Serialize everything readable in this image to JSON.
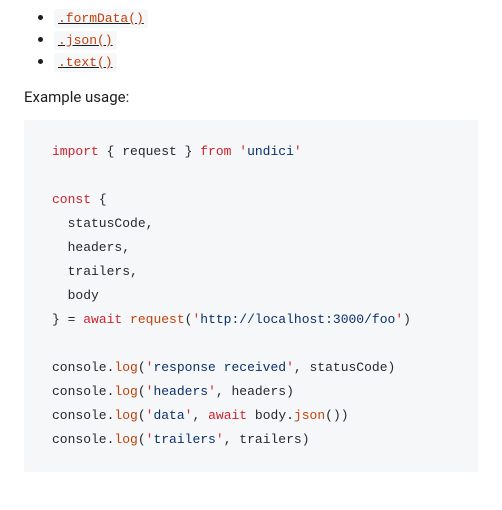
{
  "api_links": [
    ".formData()",
    ".json()",
    ".text()"
  ],
  "example_label": "Example usage:",
  "code": {
    "l1_import": "import",
    "l1_brace_open": " { ",
    "l1_request": "request",
    "l1_brace_close": " } ",
    "l1_from": "from",
    "l1_sp": " ",
    "l1_q1": "'",
    "l1_pkg": "undici",
    "l1_q2": "'",
    "l3_const": "const",
    "l3_rest": " {",
    "l4": "  statusCode,",
    "l5": "  headers,",
    "l6": "  trailers,",
    "l7": "  body",
    "l8_close": "} = ",
    "l8_await": "await",
    "l8_sp": " ",
    "l8_req": "request",
    "l8_paren_open": "(",
    "l8_q1": "'",
    "l8_url": "http://localhost:3000/foo",
    "l8_q2": "'",
    "l8_paren_close": ")",
    "l10_console": "console.",
    "l10_log": "log",
    "l10_open": "(",
    "l10_q1": "'",
    "l10_msg": "response received",
    "l10_q2": "'",
    "l10_rest": ", statusCode)",
    "l11_console": "console.",
    "l11_log": "log",
    "l11_open": "(",
    "l11_q1": "'",
    "l11_msg": "headers",
    "l11_q2": "'",
    "l11_rest": ", headers)",
    "l12_console": "console.",
    "l12_log": "log",
    "l12_open": "(",
    "l12_q1": "'",
    "l12_msg": "data",
    "l12_q2": "'",
    "l12_comma": ", ",
    "l12_await": "await",
    "l12_body": " body.",
    "l12_json": "json",
    "l12_close": "())",
    "l13_console": "console.",
    "l13_log": "log",
    "l13_open": "(",
    "l13_q1": "'",
    "l13_msg": "trailers",
    "l13_q2": "'",
    "l13_rest": ", trailers)"
  }
}
